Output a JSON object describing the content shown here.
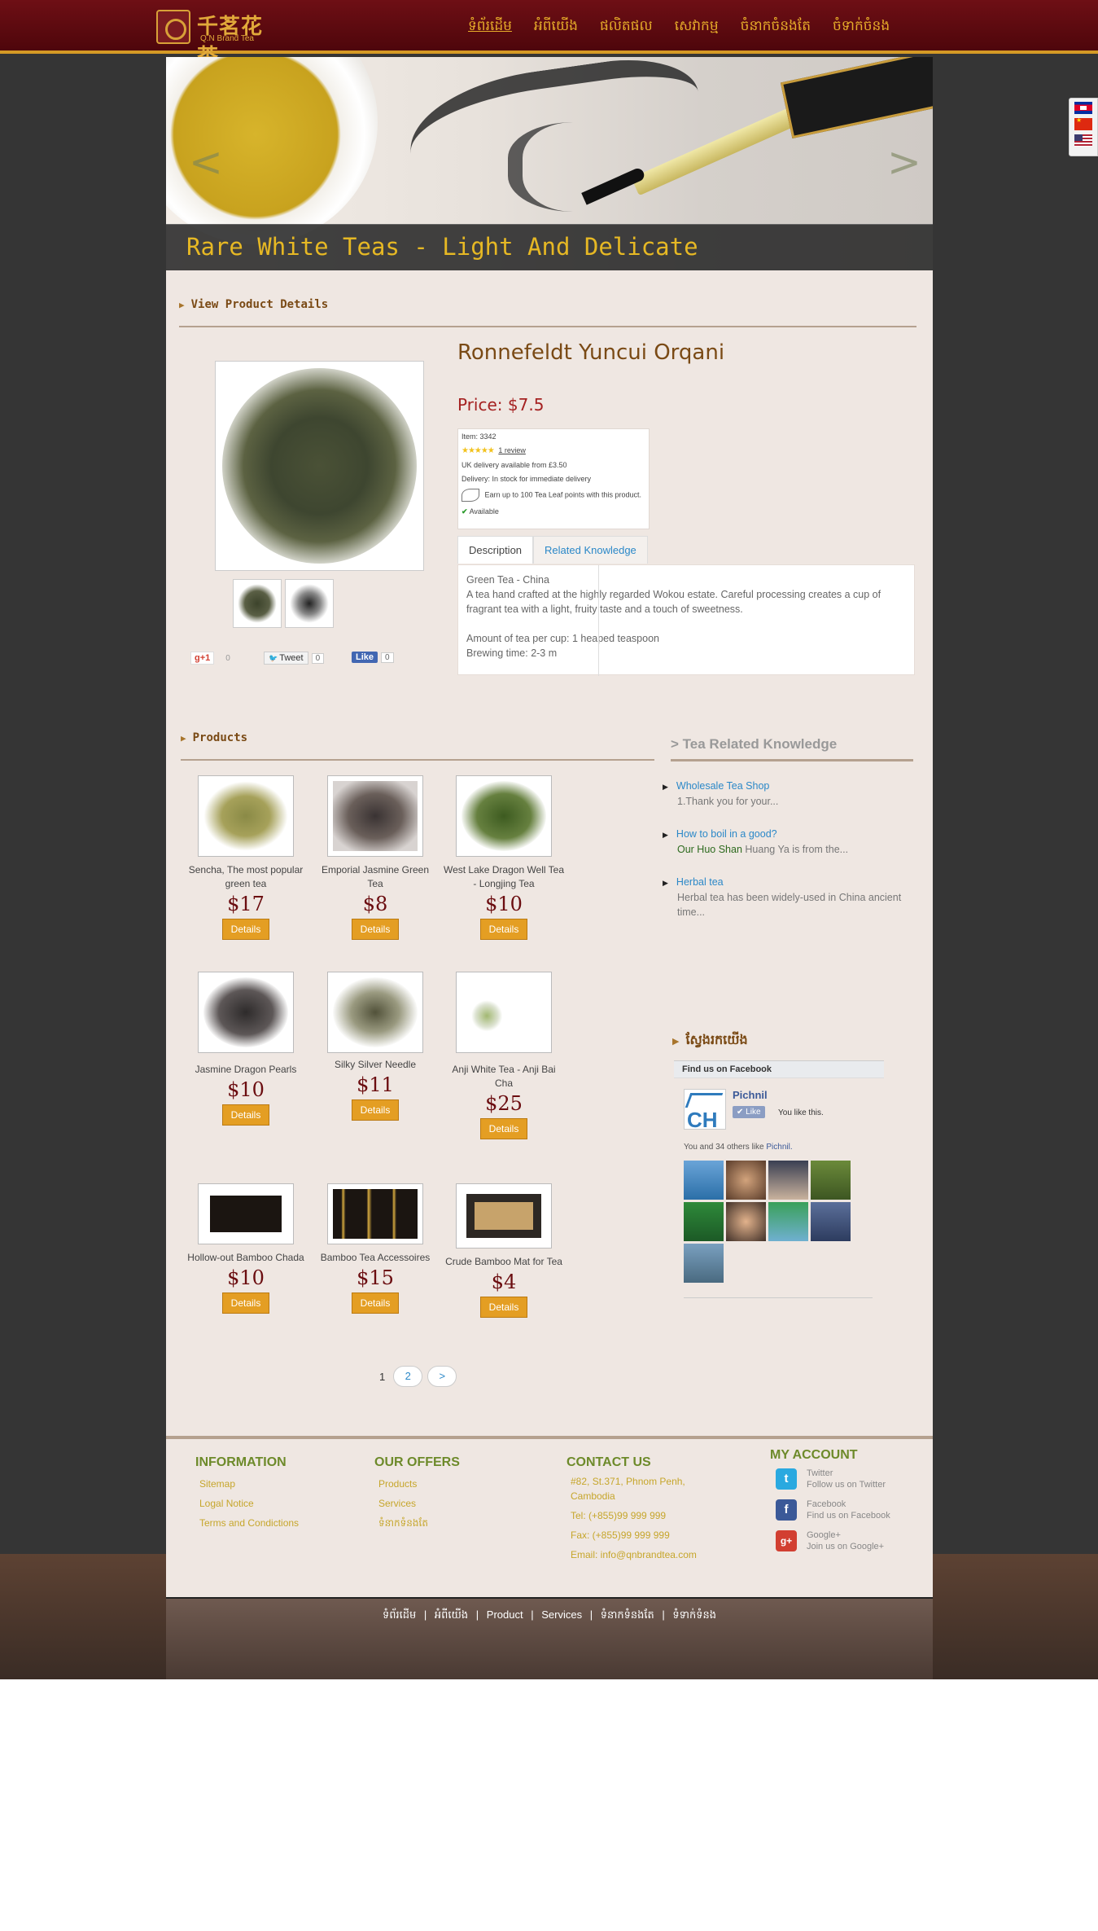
{
  "header": {
    "logo_cn": "千茗花茶",
    "logo_en": "Q.N Brand Tea",
    "nav": [
      "ទំព័រដើម",
      "អំពីយើង",
      "ផលិតផល",
      "សេវាកម្ម",
      "ចំនាកចំនងតែ",
      "ចំទាក់ចំនង"
    ]
  },
  "slider": {
    "caption": "Rare White Teas - Light And Delicate",
    "prev": "<",
    "next": ">"
  },
  "detail": {
    "section_title": "View Product Details",
    "name": "Ronnefeldt Yuncui Orqani",
    "price": "Price: $7.5",
    "item": "Item: 3342",
    "stars": "★★★★★",
    "review": "1 review",
    "delivery_uk": "UK delivery available from £3.50",
    "delivery": "Delivery: In stock for immediate delivery",
    "points": "Earn up to 100 Tea Leaf points with this product.",
    "available": "Available",
    "tabs": [
      "Description",
      "Related Knowledge"
    ],
    "description": {
      "line1": "Green Tea - China",
      "line2": "A tea hand crafted at the highly regarded Wokou estate. Careful processing creates a cup of fragrant tea with a light, fruity taste and a touch of sweetness.",
      "line3": "Amount of tea per cup: 1 heaped teaspoon",
      "line4": "Brewing time: 2-3 m"
    },
    "social": {
      "gplus": "g+1",
      "gplus_count": "0",
      "tweet": "Tweet",
      "tweet_count": "0",
      "like": "Like",
      "like_count": "0"
    }
  },
  "products": {
    "section_title": "Products",
    "button_label": "Details",
    "items": [
      {
        "name": "Sencha, The most popular green tea",
        "price": "$17"
      },
      {
        "name": "Emporial Jasmine Green Tea",
        "price": "$8"
      },
      {
        "name": "West Lake Dragon Well Tea - Longjing Tea",
        "price": "$10"
      },
      {
        "name": "Jasmine Dragon Pearls",
        "price": "$10"
      },
      {
        "name": "Silky Silver Needle",
        "price": "$11"
      },
      {
        "name": "Anji White Tea - Anji Bai Cha",
        "price": "$25"
      },
      {
        "name": "Hollow-out Bamboo Chada",
        "price": "$10"
      },
      {
        "name": "Bamboo Tea Accessoires",
        "price": "$15"
      },
      {
        "name": "Crude Bamboo Mat for Tea",
        "price": "$4"
      }
    ],
    "pager": {
      "current": "1",
      "page2": "2",
      "next": ">"
    }
  },
  "knowledge": {
    "title": "Tea Related Knowledge",
    "items": [
      {
        "title": "Wholesale Tea Shop",
        "desc": "1.Thank you for your..."
      },
      {
        "title": "How to boil in a good?",
        "desc_hl": "Our Huo Shan",
        "desc": " Huang Ya is from the..."
      },
      {
        "title": "Herbal tea",
        "desc": "Herbal tea has been widely-used in China ancient time..."
      }
    ]
  },
  "facebook": {
    "title": "ស្វែងរកយើង",
    "box_title": "Find us on Facebook",
    "page_name": "Pichnil",
    "like": "Like",
    "you_like": "You like this.",
    "others": "You and 34 others like ",
    "others_page": "Pichnil.",
    "logo_text": "CH"
  },
  "footer": {
    "information": {
      "title": "INFORMATION",
      "links": [
        "Sitemap",
        "Logal Notice",
        "Terms and Condictions"
      ]
    },
    "offers": {
      "title": "OUR OFFERS",
      "links": [
        "Products",
        "Services",
        "ទំនាកទំនងតែ"
      ]
    },
    "contact": {
      "title": "CONTACT US",
      "address": "#82, St.371, Phnom Penh, Cambodia",
      "tel": "Tel: (+855)99 999 999",
      "fax": "Fax: (+855)99 999 999",
      "email": "Email: info@qnbrandtea.com"
    },
    "account": {
      "title": "MY ACCOUNT",
      "twitter_name": "Twitter",
      "twitter_desc": "Follow us on Twitter",
      "facebook_name": "Facebook",
      "facebook_desc": "Find us on Facebook",
      "google_name": "Google+",
      "google_desc": "Join us on Google+"
    },
    "bottom_nav": [
      "ទំព័រដើម",
      "អំពីយើង",
      "Product",
      "Services",
      "ទំនាកទំនងតែ",
      "ទំទាក់ទំនង"
    ],
    "separator": "|"
  },
  "colors": {
    "header_bg": "#5e0a10",
    "gold": "#e6ac2a",
    "button": "#e49e23",
    "price": "#6b0d10",
    "footer_heading": "#6d8a2a"
  }
}
